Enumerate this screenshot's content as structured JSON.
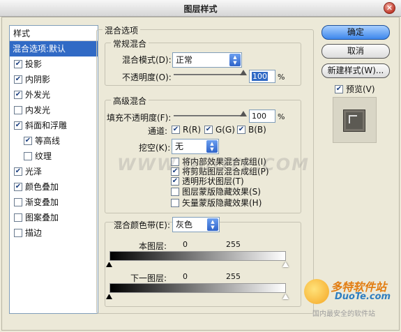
{
  "window": {
    "title": "图层样式",
    "close_glyph": "✕"
  },
  "sidebar": {
    "header": "样式",
    "items": [
      {
        "label": "混合选项:默认",
        "selected": true,
        "checkbox": false
      },
      {
        "label": "投影",
        "checked": true,
        "checkbox": true
      },
      {
        "label": "内阴影",
        "checked": true,
        "checkbox": true
      },
      {
        "label": "外发光",
        "checked": true,
        "checkbox": true
      },
      {
        "label": "内发光",
        "checked": false,
        "checkbox": true
      },
      {
        "label": "斜面和浮雕",
        "checked": true,
        "checkbox": true
      },
      {
        "label": "等高线",
        "checked": true,
        "checkbox": true,
        "sub": true
      },
      {
        "label": "纹理",
        "checked": false,
        "checkbox": true,
        "sub": true
      },
      {
        "label": "光泽",
        "checked": true,
        "checkbox": true
      },
      {
        "label": "颜色叠加",
        "checked": true,
        "checkbox": true
      },
      {
        "label": "渐变叠加",
        "checked": false,
        "checkbox": true
      },
      {
        "label": "图案叠加",
        "checked": false,
        "checkbox": true
      },
      {
        "label": "描边",
        "checked": false,
        "checkbox": true
      }
    ]
  },
  "blend_options": {
    "section_title": "混合选项",
    "general": {
      "title": "常规混合",
      "mode_label": "混合模式(D):",
      "mode_value": "正常",
      "opacity_label": "不透明度(O):",
      "opacity_value": "100",
      "percent": "%"
    },
    "advanced": {
      "title": "高级混合",
      "fill_label": "填充不透明度(F):",
      "fill_value": "100",
      "percent": "%",
      "channels_label": "通道:",
      "channel_r": "R(R)",
      "channel_g": "G(G)",
      "channel_b": "B(B)",
      "knockout_label": "挖空(K):",
      "knockout_value": "无",
      "options": [
        {
          "label": "将内部效果混合成组(I)",
          "checked": false
        },
        {
          "label": "将剪贴图层混合成组(P)",
          "checked": true
        },
        {
          "label": "透明形状图层(T)",
          "checked": true
        },
        {
          "label": "图层蒙版隐藏效果(S)",
          "checked": false
        },
        {
          "label": "矢量蒙版隐藏效果(H)",
          "checked": false
        }
      ]
    },
    "blend_if": {
      "label": "混合颜色带(E):",
      "value": "灰色",
      "this_layer_label": "本图层:",
      "this_layer_min": "0",
      "this_layer_max": "255",
      "underlying_label": "下一图层:",
      "underlying_min": "0",
      "underlying_max": "255"
    }
  },
  "buttons": {
    "ok": "确定",
    "cancel": "取消",
    "new_style": "新建样式(W)...",
    "preview_label": "预览(V)",
    "preview_checked": true
  },
  "watermark_text": "WWW.DUOTE.COM",
  "logo": {
    "line1": "多特软件站",
    "line2": "DuoTe.com",
    "line3": "国内最安全的软件站"
  },
  "colors": {
    "selection": "#316ac5",
    "ok_button": "#3d86ec"
  }
}
